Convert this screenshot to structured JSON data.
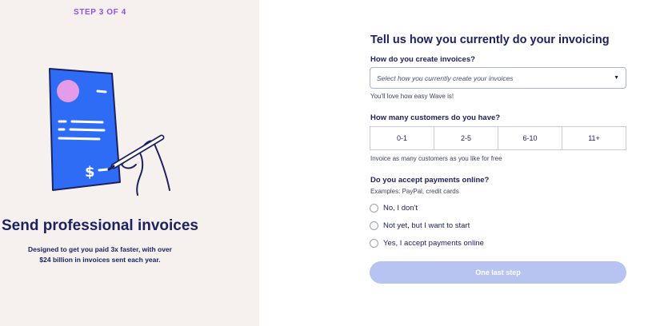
{
  "left": {
    "step": "STEP 3 OF 4",
    "title": "Send professional invoices",
    "subtitle": "Designed to get you paid 3x faster, with over $24 billion in invoices sent each year."
  },
  "form": {
    "title": "Tell us how you currently do your invoicing",
    "q1": {
      "label": "How do you create invoices?",
      "placeholder": "Select how you currently create your invoices",
      "hint": "You'll love how easy Wave is!"
    },
    "q2": {
      "label": "How many customers do you have?",
      "options": [
        "0-1",
        "2-5",
        "6-10",
        "11+"
      ],
      "hint": "Invoice as many customers as you like for free"
    },
    "q3": {
      "label": "Do you accept payments online?",
      "hint": "Examples: PayPal, credit cards",
      "options": [
        "No, I don't",
        "Not yet, but I want to start",
        "Yes, I accept payments online"
      ]
    },
    "submit_label": "One last step"
  },
  "colors": {
    "accent": "#8a54e8",
    "navy": "#1c2260",
    "invoice_blue": "#2f6cf5",
    "button_disabled": "#b7c4f2",
    "left_bg": "#f6f1ef"
  },
  "icons": {
    "illustration": "invoice-with-pen-illustration",
    "select_caret": "caret-down-icon"
  }
}
